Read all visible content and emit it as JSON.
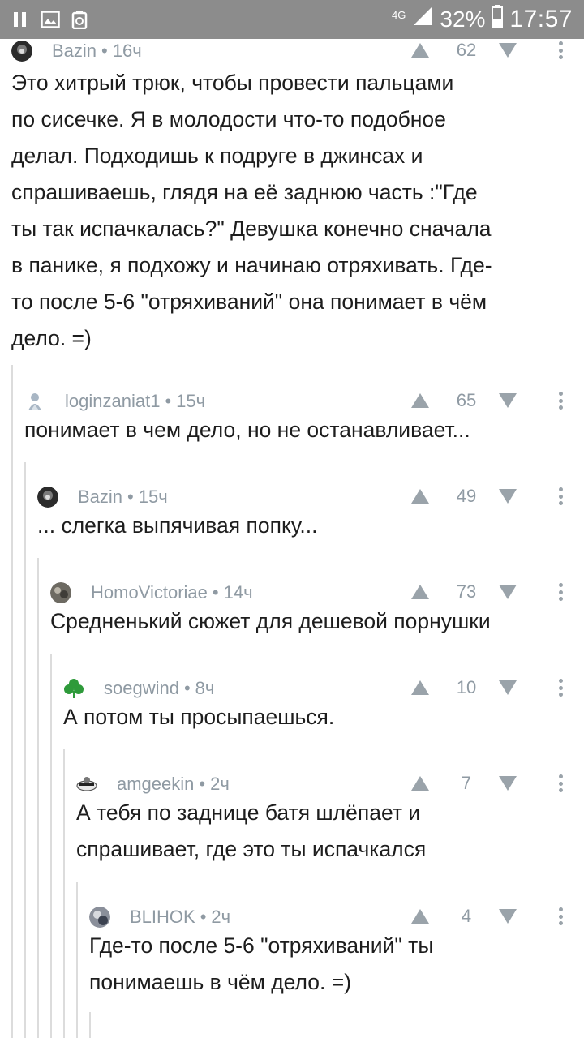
{
  "status_bar": {
    "network": "4G",
    "battery": "32%",
    "time": "17:57",
    "icons": [
      "pause-icon",
      "image-icon",
      "recycle-icon",
      "signal-icon",
      "battery-icon"
    ]
  },
  "colors": {
    "status_bar_bg": "#8c8c8c",
    "username": "#8f9aa3",
    "vote_arrow": "#9aa3aa",
    "thread_line": "#dcdcdc",
    "text": "#1d1d1d"
  },
  "comments": [
    {
      "author": "Bazin",
      "time": "16ч",
      "score": "62",
      "text": "Это хитрый трюк, чтобы провести пальцами\nпо сисечке. Я в молодости что-то подобное\nделал. Подходишь к подруге в джинсах и\nспрашиваешь, глядя на её заднюю часть :\"Где\nты так испачкалась?\" Девушка конечно сначала\nв панике, я подхожу и начинаю отряхивать. Где-\nто после 5-6 \"отряхиваний\" она понимает в чём\nдело. =)"
    },
    {
      "author": "loginzaniat1",
      "time": "15ч",
      "score": "65",
      "text": "понимает в чем дело, но не останавливает..."
    },
    {
      "author": "Bazin",
      "time": "15ч",
      "score": "49",
      "text": "... слегка выпячивая попку..."
    },
    {
      "author": "HomoVictoriae",
      "time": "14ч",
      "score": "73",
      "text": "Средненький сюжет для дешевой порнушки"
    },
    {
      "author": "soegwind",
      "time": "8ч",
      "score": "10",
      "text": "А потом ты просыпаешься."
    },
    {
      "author": "amgeekin",
      "time": "2ч",
      "score": "7",
      "text": "А тебя по заднице батя шлёпает и\nспрашивает, где это ты испачкался"
    },
    {
      "author": "BLIHOK",
      "time": "2ч",
      "score": "4",
      "text": "Где-то после 5-6 \"отряхиваний\" ты\nпонимаешь в чём дело. =)"
    }
  ]
}
